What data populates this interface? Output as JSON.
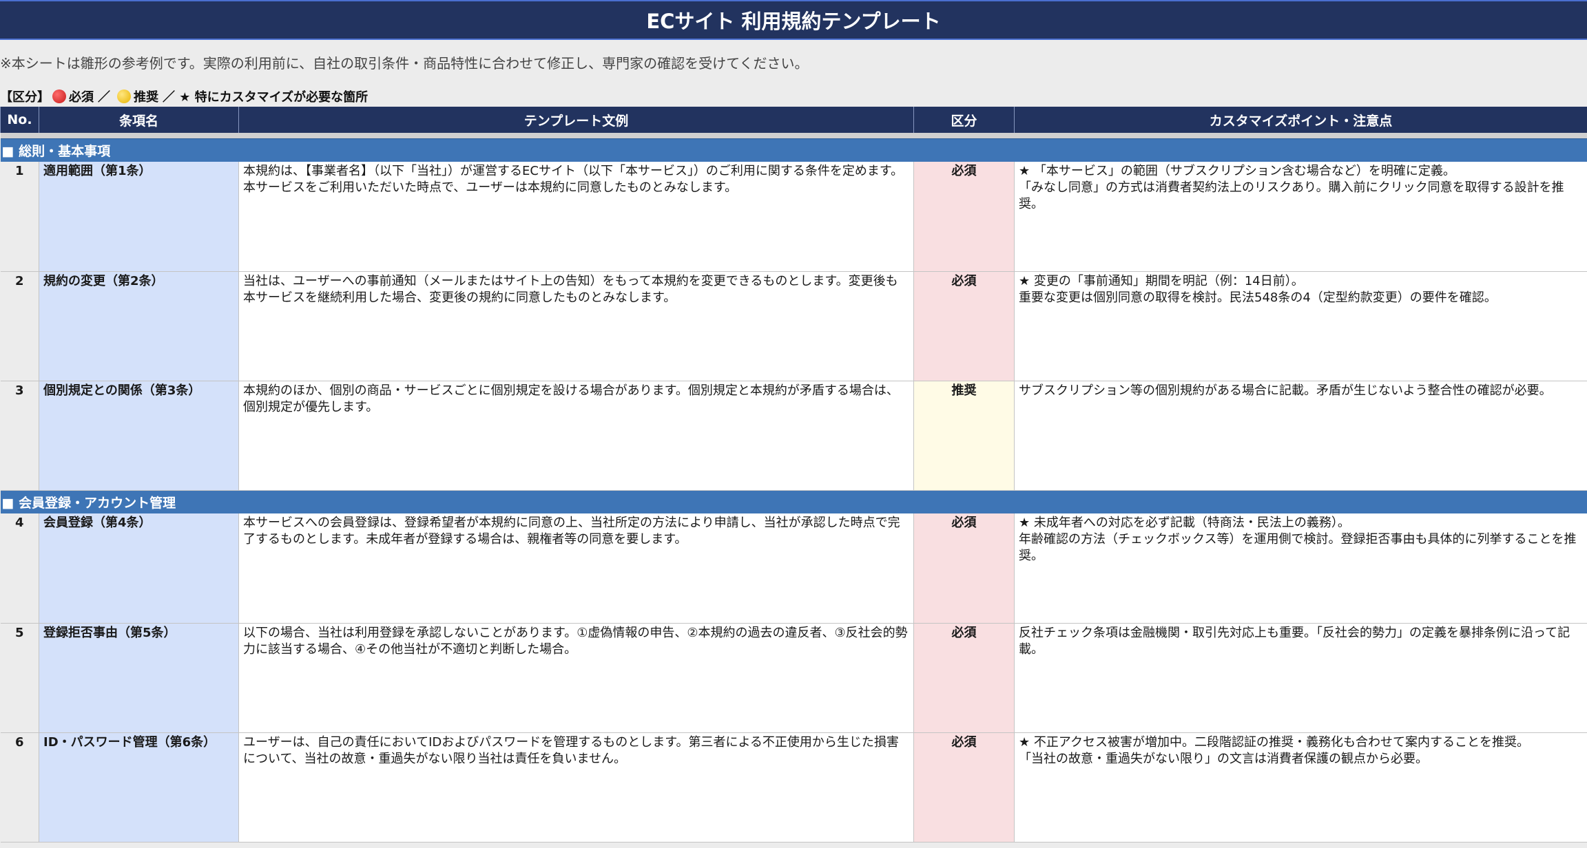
{
  "title": "ECサイト 利用規約テンプレート",
  "note": "※本シートは雛形の参考例です。実際の利用前に、自社の取引条件・商品特性に合わせて修正し、専門家の確認を受けてください。",
  "legend": {
    "prefix": "【区分】",
    "required": "必須",
    "sep1": "／",
    "recommended": "推奨",
    "sep2": "／ ★ 特にカスタマイズが必要な箇所"
  },
  "headers": {
    "no": "No.",
    "name": "条項名",
    "text": "テンプレート文例",
    "category": "区分",
    "points": "カスタマイズポイント・注意点"
  },
  "sections": [
    {
      "title": "■ 総則・基本事項",
      "rows": [
        {
          "no": "1",
          "name": "適用範囲（第1条）",
          "text": "本規約は、【事業者名】（以下「当社」）が運営するECサイト（以下「本サービス」）のご利用に関する条件を定めます。本サービスをご利用いただいた時点で、ユーザーは本規約に同意したものとみなします。",
          "category": "必須",
          "points": "★ 「本サービス」の範囲（サブスクリプション含む場合など）を明確に定義。\n「みなし同意」の方式は消費者契約法上のリスクあり。購入前にクリック同意を取得する設計を推奨。"
        },
        {
          "no": "2",
          "name": "規約の変更（第2条）",
          "text": "当社は、ユーザーへの事前通知（メールまたはサイト上の告知）をもって本規約を変更できるものとします。変更後も本サービスを継続利用した場合、変更後の規約に同意したものとみなします。",
          "category": "必須",
          "points": "★ 変更の「事前通知」期間を明記（例：14日前）。\n重要な変更は個別同意の取得を検討。民法548条の4（定型約款変更）の要件を確認。"
        },
        {
          "no": "3",
          "name": "個別規定との関係（第3条）",
          "text": "本規約のほか、個別の商品・サービスごとに個別規定を設ける場合があります。個別規定と本規約が矛盾する場合は、個別規定が優先します。",
          "category": "推奨",
          "points": "サブスクリプション等の個別規約がある場合に記載。矛盾が生じないよう整合性の確認が必要。"
        }
      ]
    },
    {
      "title": "■ 会員登録・アカウント管理",
      "rows": [
        {
          "no": "4",
          "name": "会員登録（第4条）",
          "text": "本サービスへの会員登録は、登録希望者が本規約に同意の上、当社所定の方法により申請し、当社が承認した時点で完了するものとします。未成年者が登録する場合は、親権者等の同意を要します。",
          "category": "必須",
          "points": "★ 未成年者への対応を必ず記載（特商法・民法上の義務）。\n年齢確認の方法（チェックボックス等）を運用側で検討。登録拒否事由も具体的に列挙することを推奨。"
        },
        {
          "no": "5",
          "name": "登録拒否事由（第5条）",
          "text": "以下の場合、当社は利用登録を承認しないことがあります。①虚偽情報の申告、②本規約の過去の違反者、③反社会的勢力に該当する場合、④その他当社が不適切と判断した場合。",
          "category": "必須",
          "points": "反社チェック条項は金融機関・取引先対応上も重要。「反社会的勢力」の定義を暴排条例に沿って記載。"
        },
        {
          "no": "6",
          "name": "ID・パスワード管理（第6条）",
          "text": "ユーザーは、自己の責任においてIDおよびパスワードを管理するものとします。第三者による不正使用から生じた損害について、当社の故意・重過失がない限り当社は責任を負いません。",
          "category": "必須",
          "points": "★ 不正アクセス被害が増加中。二段階認証の推奨・義務化も合わせて案内することを推奨。\n「当社の故意・重過失がない限り」の文言は消費者保護の観点から必要。"
        }
      ]
    }
  ]
}
